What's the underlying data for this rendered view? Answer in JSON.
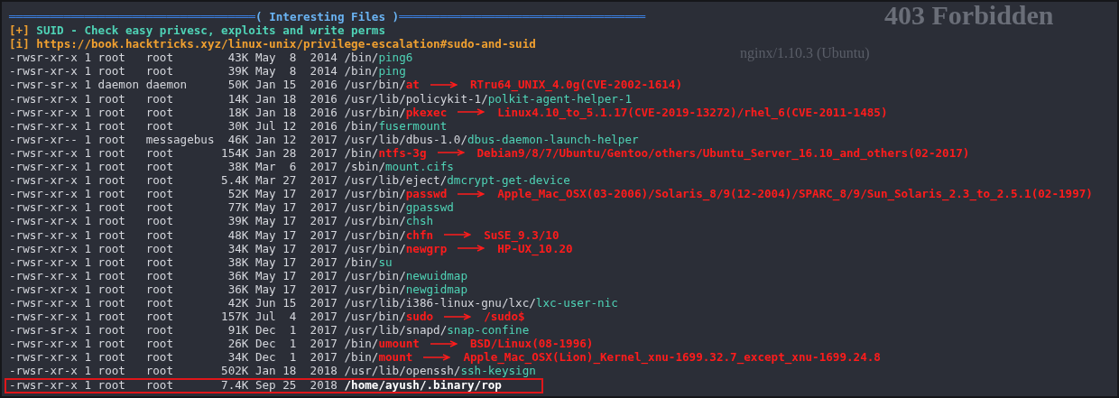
{
  "background_page": {
    "title": "403 Forbidden",
    "server": "nginx/1.10.3 (Ubuntu)"
  },
  "section_header": {
    "title": "( Interesting Files )",
    "rule_left": "════════════════════════════════════",
    "rule_right": "════════════════════════════════════"
  },
  "check": {
    "tag": "[+]",
    "text": "SUID - Check easy privesc, exploits and write perms"
  },
  "info": {
    "tag": "[i]",
    "link": "https://book.hacktricks.xyz/linux-unix/privilege-escalation#sudo-and-suid"
  },
  "rows": [
    {
      "info": "-rwsr-xr-x 1 root   root        43K May  8  2014",
      "dir": "/bin/",
      "name": "ping6",
      "kind": "normal",
      "highlighted": false
    },
    {
      "info": "-rwsr-xr-x 1 root   root        39K May  8  2014",
      "dir": "/bin/",
      "name": "ping",
      "kind": "normal",
      "highlighted": false
    },
    {
      "info": "-rwsr-sr-x 1 daemon daemon      50K Jan 15  2016",
      "dir": "/usr/bin/",
      "name": "at",
      "kind": "vulnerable",
      "exploit": "RTru64_UNIX_4.0g(CVE-2002-1614)",
      "highlighted": false
    },
    {
      "info": "-rwsr-xr-x 1 root   root        14K Jan 18  2016",
      "dir": "/usr/lib/policykit-1/",
      "name": "polkit-agent-helper-1",
      "kind": "normal",
      "highlighted": false
    },
    {
      "info": "-rwsr-xr-x 1 root   root        18K Jan 18  2016",
      "dir": "/usr/bin/",
      "name": "pkexec",
      "kind": "vulnerable",
      "exploit": "Linux4.10_to_5.1.17(CVE-2019-13272)/rhel_6(CVE-2011-1485)",
      "highlighted": false
    },
    {
      "info": "-rwsr-xr-x 1 root   root        30K Jul 12  2016",
      "dir": "/bin/",
      "name": "fusermount",
      "kind": "normal",
      "highlighted": false
    },
    {
      "info": "-rwsr-xr-- 1 root   messagebus  46K Jan 12  2017",
      "dir": "/usr/lib/dbus-1.0/",
      "name": "dbus-daemon-launch-helper",
      "kind": "normal",
      "highlighted": false
    },
    {
      "info": "-rwsr-xr-x 1 root   root       154K Jan 28  2017",
      "dir": "/bin/",
      "name": "ntfs-3g",
      "kind": "vulnerable",
      "exploit": "Debian9/8/7/Ubuntu/Gentoo/others/Ubuntu_Server_16.10_and_others(02-2017)",
      "highlighted": false
    },
    {
      "info": "-rwsr-xr-x 1 root   root        38K Mar  6  2017",
      "dir": "/sbin/",
      "name": "mount.cifs",
      "kind": "normal",
      "highlighted": false
    },
    {
      "info": "-rwsr-xr-x 1 root   root       5.4K Mar 27  2017",
      "dir": "/usr/lib/eject/",
      "name": "dmcrypt-get-device",
      "kind": "normal",
      "highlighted": false
    },
    {
      "info": "-rwsr-xr-x 1 root   root        52K May 17  2017",
      "dir": "/usr/bin/",
      "name": "passwd",
      "kind": "vulnerable",
      "exploit": "Apple_Mac_OSX(03-2006)/Solaris_8/9(12-2004)/SPARC_8/9/Sun_Solaris_2.3_to_2.5.1(02-1997)",
      "highlighted": false
    },
    {
      "info": "-rwsr-xr-x 1 root   root        77K May 17  2017",
      "dir": "/usr/bin/",
      "name": "gpasswd",
      "kind": "normal",
      "highlighted": false
    },
    {
      "info": "-rwsr-xr-x 1 root   root        39K May 17  2017",
      "dir": "/usr/bin/",
      "name": "chsh",
      "kind": "normal",
      "highlighted": false
    },
    {
      "info": "-rwsr-xr-x 1 root   root        48K May 17  2017",
      "dir": "/usr/bin/",
      "name": "chfn",
      "kind": "vulnerable",
      "exploit": "SuSE_9.3/10",
      "highlighted": false
    },
    {
      "info": "-rwsr-xr-x 1 root   root        34K May 17  2017",
      "dir": "/usr/bin/",
      "name": "newgrp",
      "kind": "vulnerable",
      "exploit": "HP-UX_10.20",
      "highlighted": false
    },
    {
      "info": "-rwsr-xr-x 1 root   root        38K May 17  2017",
      "dir": "/bin/",
      "name": "su",
      "kind": "normal",
      "highlighted": false
    },
    {
      "info": "-rwsr-xr-x 1 root   root        36K May 17  2017",
      "dir": "/usr/bin/",
      "name": "newuidmap",
      "kind": "normal",
      "highlighted": false
    },
    {
      "info": "-rwsr-xr-x 1 root   root        36K May 17  2017",
      "dir": "/usr/bin/",
      "name": "newgidmap",
      "kind": "normal",
      "highlighted": false
    },
    {
      "info": "-rwsr-xr-x 1 root   root        42K Jun 15  2017",
      "dir": "/usr/lib/i386-linux-gnu/lxc/",
      "name": "lxc-user-nic",
      "kind": "normal",
      "highlighted": false
    },
    {
      "info": "-rwsr-xr-x 1 root   root       157K Jul  4  2017",
      "dir": "/usr/bin/",
      "name": "sudo",
      "kind": "vulnerable",
      "exploit": "/sudo$",
      "highlighted": false
    },
    {
      "info": "-rwsr-sr-x 1 root   root        91K Dec  1  2017",
      "dir": "/usr/lib/snapd/",
      "name": "snap-confine",
      "kind": "normal",
      "highlighted": false
    },
    {
      "info": "-rwsr-xr-x 1 root   root        26K Dec  1  2017",
      "dir": "/bin/",
      "name": "umount",
      "kind": "vulnerable",
      "exploit": "BSD/Linux(08-1996)",
      "highlighted": false
    },
    {
      "info": "-rwsr-xr-x 1 root   root        34K Dec  1  2017",
      "dir": "/bin/",
      "name": "mount",
      "kind": "vulnerable",
      "exploit": "Apple_Mac_OSX(Lion)_Kernel_xnu-1699.32.7_except_xnu-1699.24.8",
      "highlighted": false
    },
    {
      "info": "-rwsr-xr-x 1 root   root       502K Jan 18  2018",
      "dir": "/usr/lib/openssh/",
      "name": "ssh-keysign",
      "kind": "normal",
      "highlighted": false
    },
    {
      "info": "-rwsr-xr-x 1 root   root       7.4K Sep 25  2018",
      "dir": "/home/ayush/.binary/",
      "name": "rop",
      "kind": "unknown",
      "highlighted": true
    }
  ]
}
